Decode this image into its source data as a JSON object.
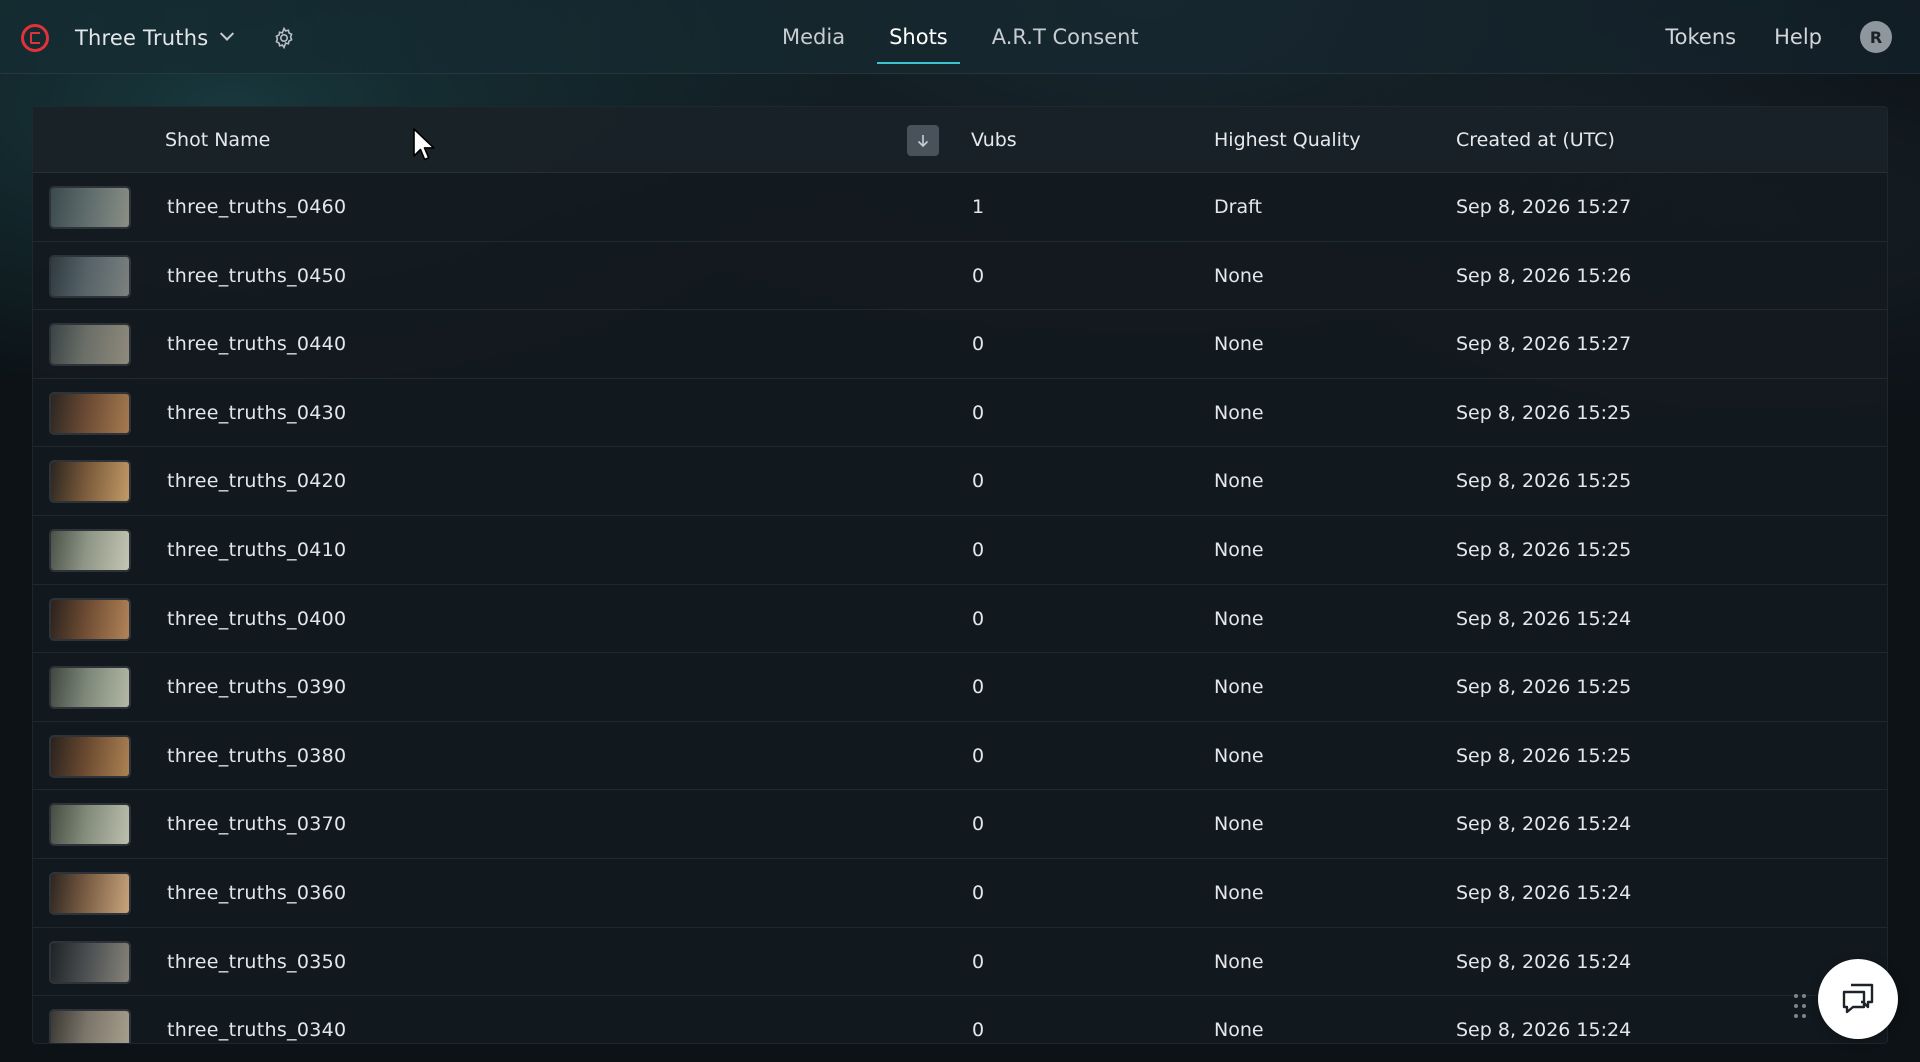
{
  "app": {
    "project_name": "Three Truths",
    "logo": "brand-logo",
    "colors": {
      "accent": "#3fc2d0",
      "brand": "#e1323a"
    }
  },
  "nav": {
    "tabs": [
      {
        "label": "Media",
        "active": false
      },
      {
        "label": "Shots",
        "active": true
      },
      {
        "label": "A.R.T Consent",
        "active": false
      }
    ],
    "tokens_label": "Tokens",
    "help_label": "Help",
    "avatar_initial": "R"
  },
  "table": {
    "columns": {
      "shot_name": "Shot Name",
      "vubs": "Vubs",
      "highest_quality": "Highest Quality",
      "created_at": "Created at (UTC)"
    },
    "sort_icon": "arrow-down-icon",
    "rows": [
      {
        "name": "three_truths_0460",
        "vubs": "1",
        "quality": "Draft",
        "created": "Sep 8, 2026 15:27"
      },
      {
        "name": "three_truths_0450",
        "vubs": "0",
        "quality": "None",
        "created": "Sep 8, 2026 15:26"
      },
      {
        "name": "three_truths_0440",
        "vubs": "0",
        "quality": "None",
        "created": "Sep 8, 2026 15:27"
      },
      {
        "name": "three_truths_0430",
        "vubs": "0",
        "quality": "None",
        "created": "Sep 8, 2026 15:25"
      },
      {
        "name": "three_truths_0420",
        "vubs": "0",
        "quality": "None",
        "created": "Sep 8, 2026 15:25"
      },
      {
        "name": "three_truths_0410",
        "vubs": "0",
        "quality": "None",
        "created": "Sep 8, 2026 15:25"
      },
      {
        "name": "three_truths_0400",
        "vubs": "0",
        "quality": "None",
        "created": "Sep 8, 2026 15:24"
      },
      {
        "name": "three_truths_0390",
        "vubs": "0",
        "quality": "None",
        "created": "Sep 8, 2026 15:25"
      },
      {
        "name": "three_truths_0380",
        "vubs": "0",
        "quality": "None",
        "created": "Sep 8, 2026 15:25"
      },
      {
        "name": "three_truths_0370",
        "vubs": "0",
        "quality": "None",
        "created": "Sep 8, 2026 15:24"
      },
      {
        "name": "three_truths_0360",
        "vubs": "0",
        "quality": "None",
        "created": "Sep 8, 2026 15:24"
      },
      {
        "name": "three_truths_0350",
        "vubs": "0",
        "quality": "None",
        "created": "Sep 8, 2026 15:24"
      },
      {
        "name": "three_truths_0340",
        "vubs": "0",
        "quality": "None",
        "created": "Sep 8, 2026 15:24"
      }
    ]
  },
  "widgets": {
    "chat_icon": "chat-bubble-icon",
    "drag_icon": "drag-handle-icon"
  }
}
